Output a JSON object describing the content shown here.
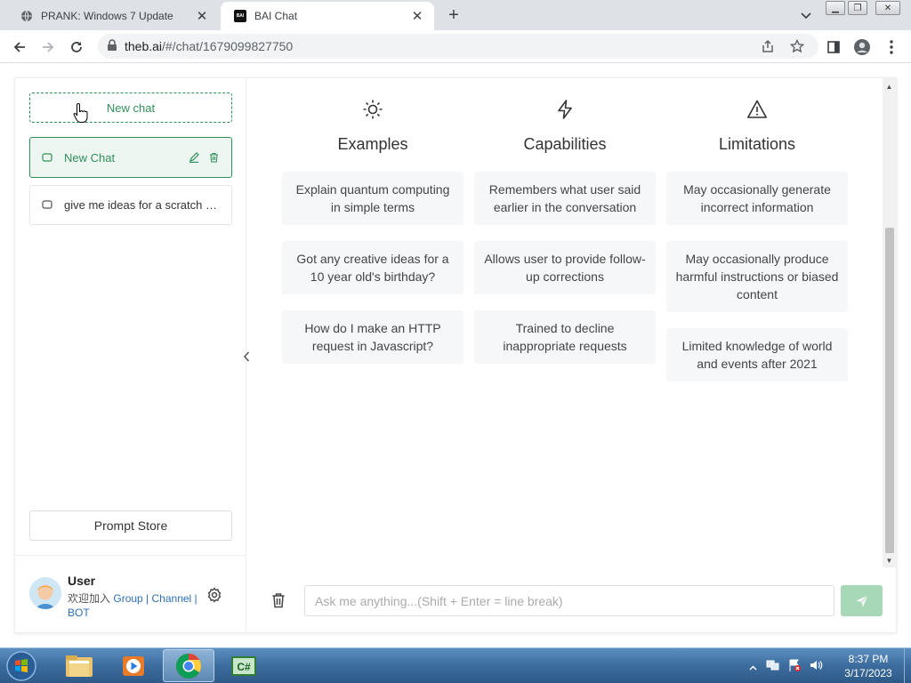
{
  "browser": {
    "tabs": [
      {
        "title": "PRANK: Windows 7 Update",
        "favicon": "globe-icon"
      },
      {
        "title": "BAI Chat",
        "favicon": "bai-logo",
        "active": true
      }
    ],
    "favicon_text": "BAI",
    "url_host": "theb.ai",
    "url_path": "/#/chat/1679099827750"
  },
  "sidebar": {
    "new_chat_label": "New chat",
    "history": [
      {
        "label": "New Chat",
        "active": true
      },
      {
        "label": "give me ideas for a scratch game"
      }
    ],
    "prompt_store_label": "Prompt Store",
    "user": {
      "name": "User",
      "welcome": "欢迎加入",
      "links": [
        "Group",
        "Channel",
        "BOT"
      ],
      "separator": " | "
    }
  },
  "main": {
    "columns": [
      {
        "title": "Examples",
        "icon": "sun-icon",
        "items": [
          "Explain quantum computing in simple terms",
          "Got any creative ideas for a 10 year old's birthday?",
          "How do I make an HTTP request in Javascript?"
        ]
      },
      {
        "title": "Capabilities",
        "icon": "lightning-icon",
        "items": [
          "Remembers what user said earlier in the conversation",
          "Allows user to provide follow-up corrections",
          "Trained to decline inappropriate requests"
        ]
      },
      {
        "title": "Limitations",
        "icon": "warning-icon",
        "items": [
          "May occasionally generate incorrect information",
          "May occasionally produce harmful instructions or biased content",
          "Limited knowledge of world and events after 2021"
        ]
      }
    ],
    "input_placeholder": "Ask me anything...(Shift + Enter = line break)"
  },
  "taskbar": {
    "time": "8:37 PM",
    "date": "3/17/2023",
    "apps": [
      "explorer-icon",
      "media-player-icon",
      "chrome-icon",
      "csharp-icon"
    ],
    "active_app": "chrome-icon",
    "csharp_label": "C#"
  },
  "colors": {
    "accent": "#2f8f5b",
    "send_button": "#a7d8b8",
    "link": "#2d6fb4"
  }
}
